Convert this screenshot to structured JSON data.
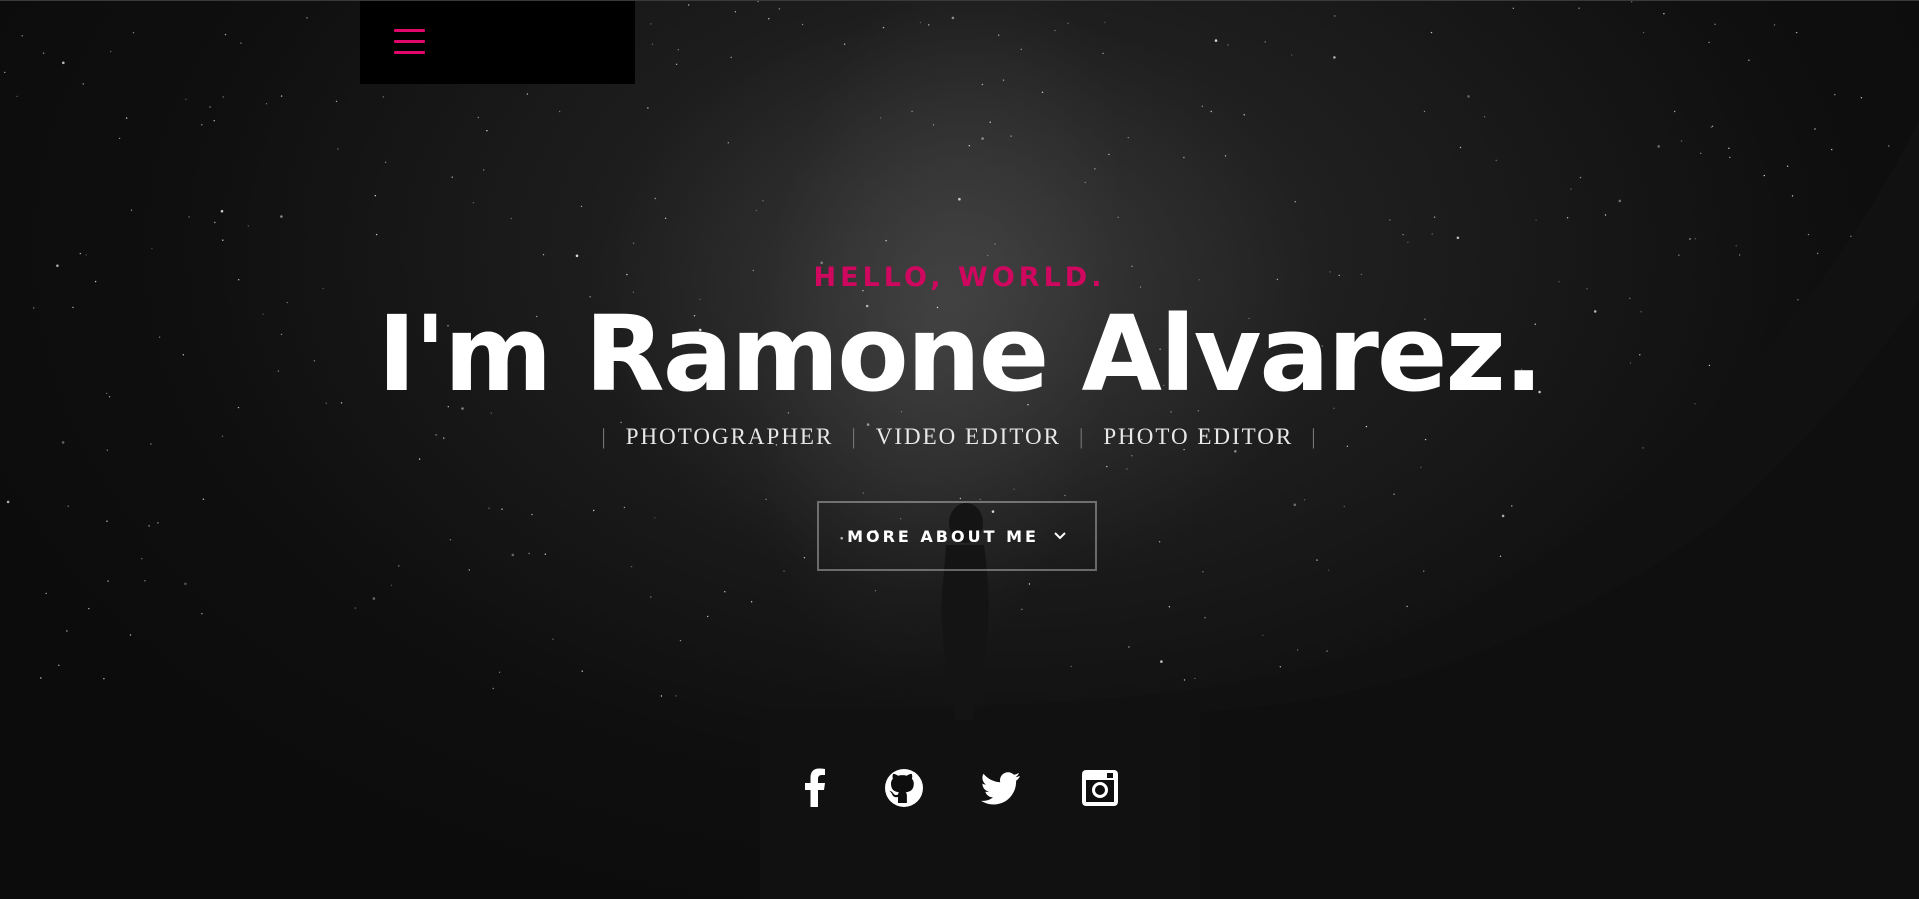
{
  "nav": {
    "menu_icon": "hamburger-icon",
    "accent_color": "#e0086b"
  },
  "intro": {
    "greeting": "HELLO, WORLD.",
    "headline": "I'm Ramone Alvarez.",
    "roles": [
      "PHOTOGRAPHER",
      "VIDEO EDITOR",
      "PHOTO EDITOR"
    ],
    "separator": "|",
    "more_button_label": "MORE ABOUT ME",
    "more_button_icon": "chevron-down-icon"
  },
  "social": {
    "links": [
      {
        "icon": "facebook-icon"
      },
      {
        "icon": "github-icon"
      },
      {
        "icon": "twitter-icon"
      },
      {
        "icon": "instagram-icon"
      }
    ]
  },
  "colors": {
    "accent": "#d0075f",
    "background": "#0e0e0e",
    "text": "#ffffff"
  }
}
